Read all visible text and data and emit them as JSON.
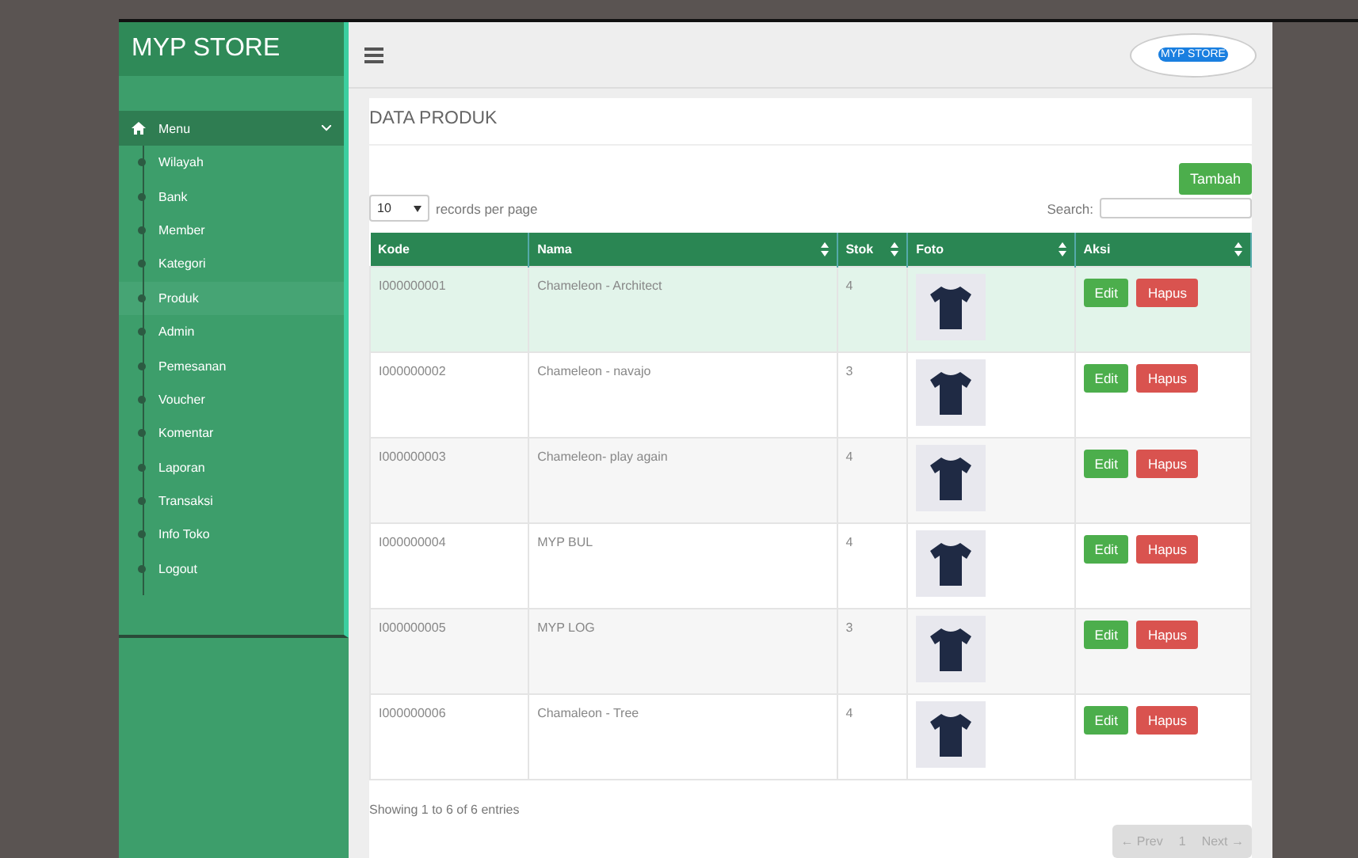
{
  "sidebar": {
    "brand": "MYP STORE",
    "menu": {
      "label": "Menu",
      "expanded": true
    },
    "items": [
      {
        "label": "Wilayah",
        "selected": false
      },
      {
        "label": "Bank",
        "selected": false
      },
      {
        "label": "Member",
        "selected": false
      },
      {
        "label": "Kategori",
        "selected": false
      },
      {
        "label": "Produk",
        "selected": true
      },
      {
        "label": "Admin",
        "selected": false
      },
      {
        "label": "Pemesanan",
        "selected": false
      },
      {
        "label": "Voucher",
        "selected": false
      },
      {
        "label": "Komentar",
        "selected": false
      },
      {
        "label": "Laporan",
        "selected": false
      },
      {
        "label": "Transaksi",
        "selected": false
      },
      {
        "label": "Info Toko",
        "selected": false
      },
      {
        "label": "Logout",
        "selected": false
      }
    ]
  },
  "topbar": {
    "logo": "MYP STORE"
  },
  "panel": {
    "title": "DATA PRODUK",
    "add_button": "Tambah",
    "page_size": "10",
    "page_size_label": "records per page",
    "search_label": "Search:",
    "table": {
      "columns": [
        {
          "label": "Kode",
          "sortable": false
        },
        {
          "label": "Nama",
          "sortable": true
        },
        {
          "label": "Stok",
          "sortable": true
        },
        {
          "label": "Foto",
          "sortable": true
        },
        {
          "label": "Aksi",
          "sortable": true
        }
      ],
      "rows": [
        {
          "kode": "I000000001",
          "nama": "Chameleon - Architect",
          "stok": "4",
          "highlighted": true,
          "edit": "Edit",
          "hapus": "Hapus"
        },
        {
          "kode": "I000000002",
          "nama": "Chameleon - navajo",
          "stok": "3",
          "highlighted": false,
          "edit": "Edit",
          "hapus": "Hapus"
        },
        {
          "kode": "I000000003",
          "nama": "Chameleon- play again",
          "stok": "4",
          "highlighted": false,
          "edit": "Edit",
          "hapus": "Hapus"
        },
        {
          "kode": "I000000004",
          "nama": "MYP BUL",
          "stok": "4",
          "highlighted": false,
          "edit": "Edit",
          "hapus": "Hapus"
        },
        {
          "kode": "I000000005",
          "nama": "MYP LOG",
          "stok": "3",
          "highlighted": false,
          "edit": "Edit",
          "hapus": "Hapus"
        },
        {
          "kode": "I000000006",
          "nama": "Chamaleon - Tree",
          "stok": "4",
          "highlighted": false,
          "edit": "Edit",
          "hapus": "Hapus"
        }
      ]
    },
    "info": "Showing 1 to 6 of 6 entries",
    "pagination": [
      {
        "label": "← Prev",
        "disabled": true
      },
      {
        "label": "1",
        "disabled": true
      },
      {
        "label": "Next →",
        "disabled": true
      }
    ]
  }
}
